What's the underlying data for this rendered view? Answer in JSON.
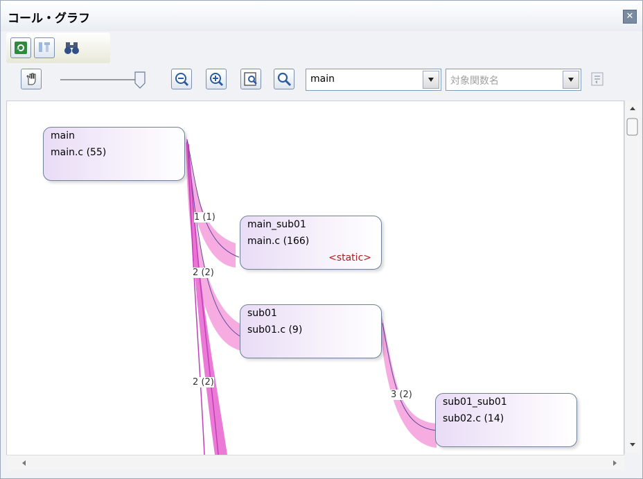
{
  "window": {
    "title": "コール・グラフ",
    "close_icon": "close-icon"
  },
  "toolbar1": {
    "refresh_icon": "refresh-icon",
    "pin_icon": "pin-icon",
    "binoculars_icon": "binoculars-icon"
  },
  "toolbar2": {
    "hand_icon": "hand-icon",
    "zoom_slider_icon": "zoom-slider-icon",
    "zoom_out_icon": "zoom-out-icon",
    "zoom_in_icon": "zoom-in-icon",
    "fit_icon": "fit-icon",
    "search_icon": "search-icon",
    "function_combo": {
      "value": "main"
    },
    "target_combo": {
      "placeholder": "対象関数名"
    },
    "jump_icon": "jump-icon"
  },
  "graph": {
    "nodes": [
      {
        "id": "main",
        "name": "main",
        "file": "main.c (55)",
        "tag": ""
      },
      {
        "id": "main_sub01",
        "name": "main_sub01",
        "file": "main.c (166)",
        "tag": "<static>"
      },
      {
        "id": "sub01",
        "name": "sub01",
        "file": "sub01.c (9)",
        "tag": ""
      },
      {
        "id": "sub01_sub01",
        "name": "sub01_sub01",
        "file": "sub02.c (14)",
        "tag": ""
      }
    ],
    "edges": [
      {
        "from": "main",
        "to": "main_sub01",
        "label": "1 (1)"
      },
      {
        "from": "main",
        "to": "sub01",
        "label": "2 (2)"
      },
      {
        "from": "main",
        "to": "offscreen",
        "label": "2 (2)"
      },
      {
        "from": "sub01",
        "to": "sub01_sub01",
        "label": "3 (2)"
      }
    ],
    "colors": {
      "edge_band": "#f48fd8",
      "edge_line": "#5d4a9a",
      "static_tag": "#a8201e"
    }
  }
}
